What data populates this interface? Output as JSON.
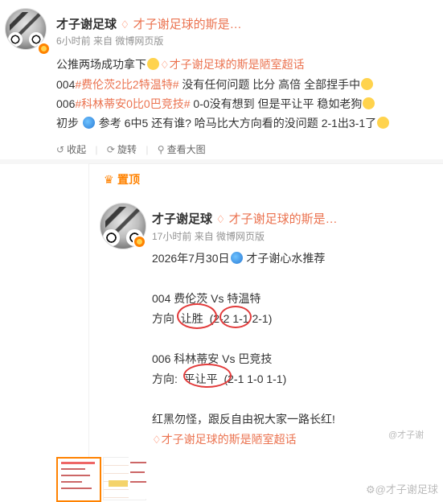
{
  "post": {
    "author": "才子谢足球",
    "super_topic": "才子谢足球的斯是…",
    "time": "6小时前",
    "source": "来自 微博网页版",
    "lines": [
      "公推两场成功拿下",
      "004",
      "006",
      "初步",
      "参考 6中5 还有谁? 哈马比大方向看的没问题 2-1出3-1了"
    ],
    "line1_link": "才子谢足球的斯是陋室超话",
    "line2_tag": "#费伦茨2比2特温特#",
    "line2_rest": " 没有任何问题 比分 高倍 全部捏手中",
    "line3_tag": "#科林蒂安0比0巴竞技#",
    "line3_rest": " 0-0没有想到 但是平让平 稳如老狗"
  },
  "toolbar": {
    "collect": "收起",
    "rotate": "旋转",
    "view_large": "查看大图"
  },
  "pinned": {
    "label": "置顶",
    "author": "才子谢足球",
    "super_topic": "才子谢足球的斯是…",
    "time": "17小时前",
    "source": "来自 微博网页版",
    "date_line": "2026年7月30日",
    "date_suffix": " 才子谢心水推荐",
    "match1": "004 费伦茨 Vs 特温特",
    "m1_prefix": "方向",
    "m1_pick": "让胜",
    "m1_score_circled": "(2-2",
    "m1_score_rest": " 1-1 2-1)",
    "match2": "006 科林蒂安 Vs 巴竞技",
    "m2_prefix": "方向:",
    "m2_pick": "平让平",
    "m2_scores": "(2-1 1-0 1-1)",
    "closing": "红黑勿怪，跟反自由祝大家一路长红!",
    "topic_link": "才子谢足球的斯是陋室超话"
  },
  "watermark": "@才子谢足球",
  "watermark_small": "@才子谢"
}
